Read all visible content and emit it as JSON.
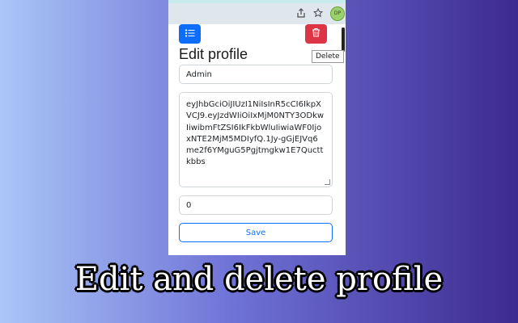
{
  "background": {
    "gradient_start": "#a8c4f5",
    "gradient_end": "#3f2a92"
  },
  "browser_toolbar": {
    "icons": [
      "share-icon",
      "star-icon",
      "extension-avatar-icon"
    ],
    "avatar_text": "DP"
  },
  "toolbar": {
    "list_button_icon": "list-icon",
    "delete_button_icon": "trash-icon",
    "delete_tooltip": "Delete",
    "primary_color": "#0d6efd",
    "danger_color": "#dc3545"
  },
  "form": {
    "title": "Edit profile",
    "name_value": "Admin",
    "token_value": "eyJhbGciOiJIUzI1NiIsInR5cCI6IkpXVCJ9.eyJzdWIiOiIxMjM0NTY3ODkwIiwibmFtZSI6IkFkbWluIiwiaWF0IjoxNTE2MjM5MDIyfQ.1Jy-gGjEJVq6me2f6YMguG5Pgjtmgkw1E7Qucttkbbs",
    "number_value": "0",
    "save_label": "Save"
  },
  "caption": "Edit and delete profile"
}
